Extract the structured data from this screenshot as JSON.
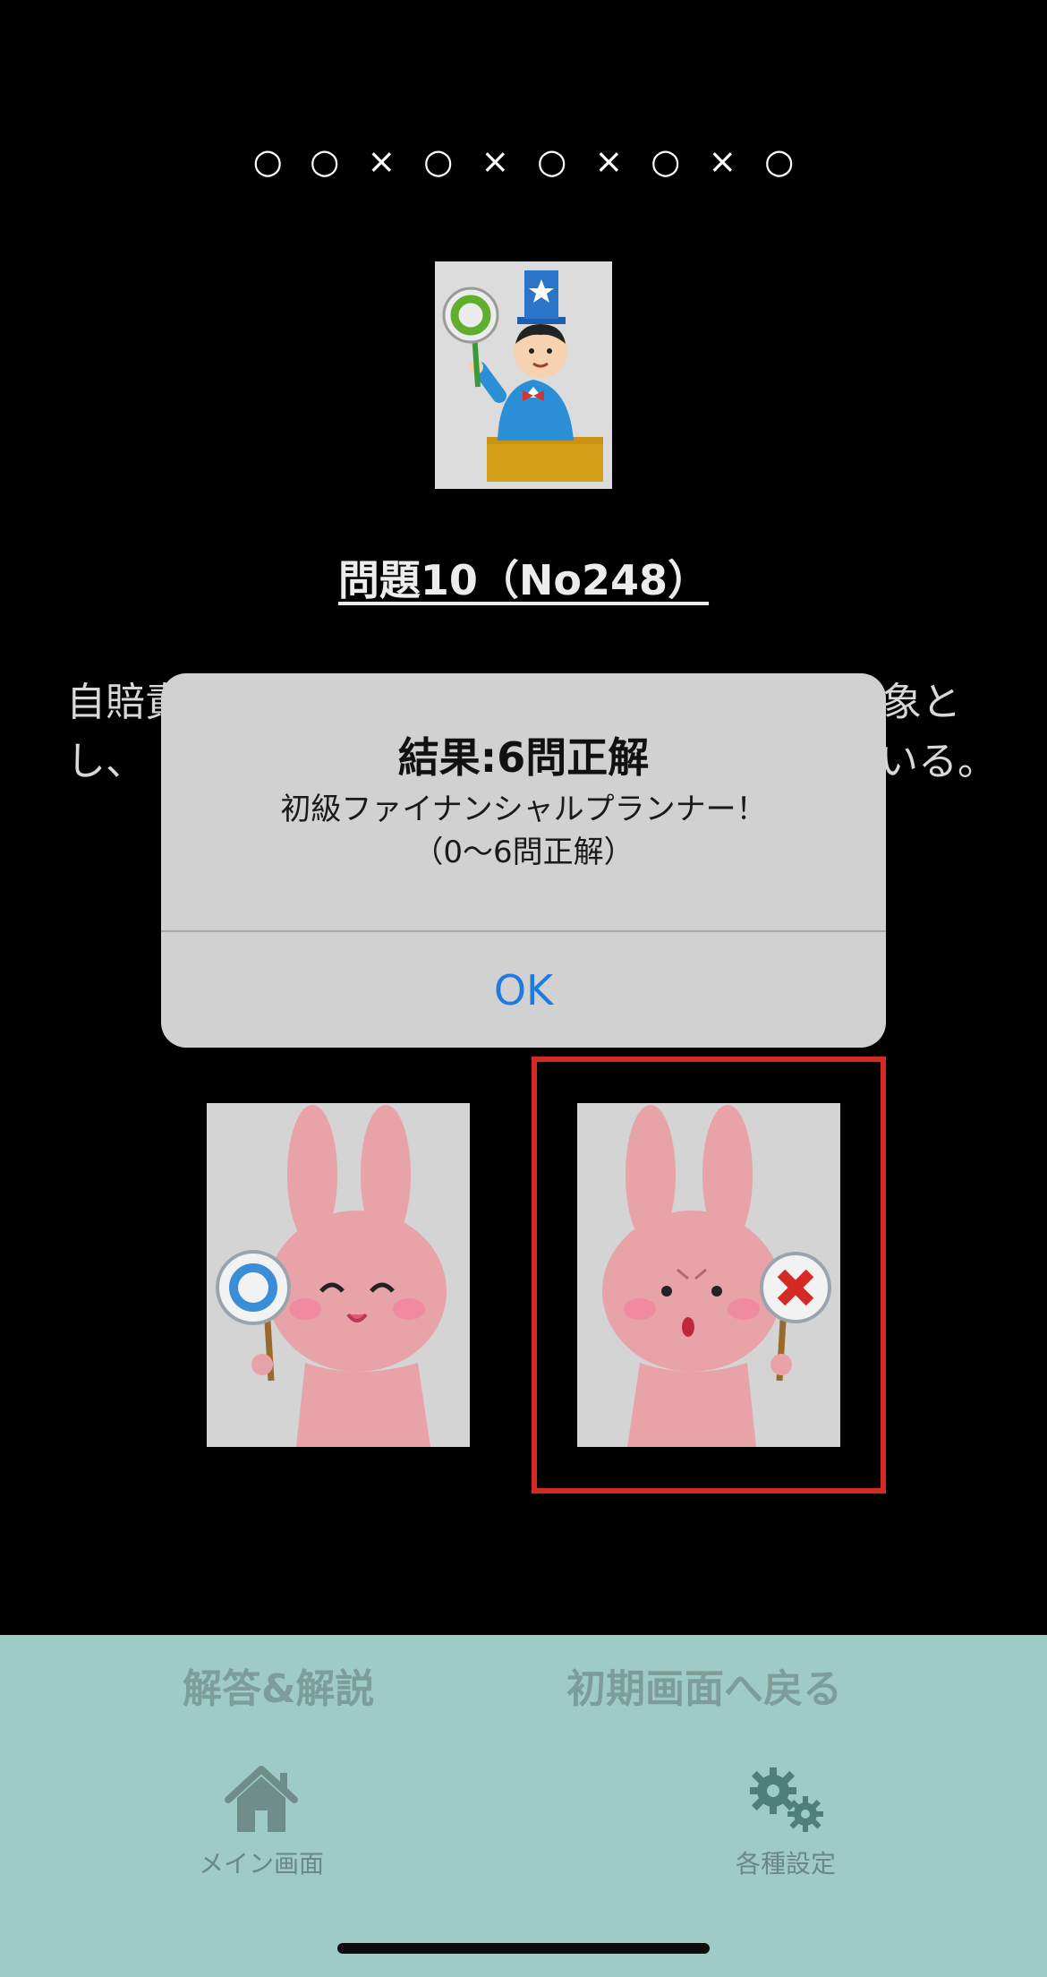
{
  "results_row": {
    "marks": [
      "○",
      "○",
      "×",
      "○",
      "×",
      "○",
      "×",
      "○",
      "×",
      "○"
    ]
  },
  "question": {
    "title": "問題10（No248）",
    "text_visible_left_line1": "自賠責",
    "text_visible_right_line1": "象と",
    "text_visible_left_line2": "し、",
    "text_visible_right_line2": "いる。"
  },
  "dialog": {
    "title": "結果:6問正解",
    "message_line1": "初級ファイナンシャルプランナー！",
    "message_line2": "（0〜6問正解）",
    "ok_label": "OK"
  },
  "answers": {
    "correct_choice_icon": "rabbit-maru-icon",
    "wrong_choice_icon": "rabbit-batsu-icon",
    "selected": "wrong"
  },
  "bottom_actions": {
    "answer_label": "解答&解説",
    "home_label": "初期画面へ戻る"
  },
  "tabs": {
    "main_label": "メイン画面",
    "settings_label": "各種設定"
  },
  "colors": {
    "bottom_bar": "#9ecbc6",
    "dialog_ok": "#1f7ae0",
    "highlight": "#d42a26"
  }
}
